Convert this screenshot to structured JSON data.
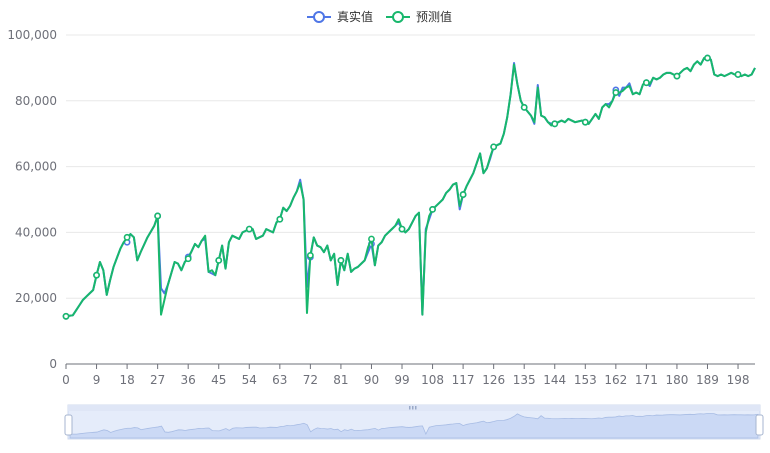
{
  "chart_data": {
    "type": "line",
    "title": "",
    "xlabel": "",
    "ylabel": "",
    "legend_position": "top-center",
    "x_tick_labels": [
      "0",
      "9",
      "18",
      "27",
      "36",
      "45",
      "54",
      "63",
      "72",
      "81",
      "90",
      "99",
      "108",
      "117",
      "126",
      "135",
      "144",
      "153",
      "162",
      "171",
      "180",
      "189",
      "198"
    ],
    "y_tick_labels": [
      "0",
      "20,000",
      "40,000",
      "60,000",
      "80,000",
      "100,000"
    ],
    "x_range": [
      0,
      203
    ],
    "ylim": [
      0,
      100000
    ],
    "grid": "horizontal",
    "anchors": [
      [
        0,
        14500
      ],
      [
        2,
        14800
      ],
      [
        5,
        19500
      ],
      [
        6,
        20500
      ],
      [
        8,
        22500
      ],
      [
        9,
        27000
      ],
      [
        10,
        31000
      ],
      [
        11,
        28500
      ],
      [
        12,
        21000
      ],
      [
        13,
        25500
      ],
      [
        14,
        29500
      ],
      [
        16,
        35000
      ],
      [
        17,
        37000
      ],
      [
        18,
        38500
      ],
      [
        19,
        39500
      ],
      [
        20,
        38500
      ],
      [
        21,
        31500
      ],
      [
        22,
        34000
      ],
      [
        24,
        38500
      ],
      [
        26,
        42000
      ],
      [
        27,
        45000
      ],
      [
        28,
        15000
      ],
      [
        29,
        19500
      ],
      [
        30,
        24000
      ],
      [
        32,
        31000
      ],
      [
        33,
        30500
      ],
      [
        34,
        28500
      ],
      [
        35,
        31000
      ],
      [
        36,
        32000
      ],
      [
        38,
        36500
      ],
      [
        39,
        35500
      ],
      [
        40,
        37500
      ],
      [
        41,
        39000
      ],
      [
        42,
        28000
      ],
      [
        43,
        28500
      ],
      [
        44,
        27000
      ],
      [
        46,
        36000
      ],
      [
        47,
        29000
      ],
      [
        48,
        37000
      ],
      [
        49,
        39000
      ],
      [
        51,
        38000
      ],
      [
        52,
        40000
      ],
      [
        54,
        41000
      ],
      [
        55,
        41000
      ],
      [
        56,
        38000
      ],
      [
        58,
        39000
      ],
      [
        59,
        41000
      ],
      [
        61,
        40000
      ],
      [
        62,
        43000
      ],
      [
        63,
        44000
      ],
      [
        64,
        47500
      ],
      [
        65,
        46500
      ],
      [
        66,
        48000
      ],
      [
        67,
        50500
      ],
      [
        68,
        52500
      ],
      [
        69,
        55000
      ],
      [
        70,
        50000
      ],
      [
        71,
        15500
      ],
      [
        72,
        33000
      ],
      [
        73,
        38500
      ],
      [
        74,
        36000
      ],
      [
        75,
        35500
      ],
      [
        76,
        34000
      ],
      [
        77,
        36000
      ],
      [
        78,
        31500
      ],
      [
        79,
        33500
      ],
      [
        80,
        24000
      ],
      [
        81,
        31500
      ],
      [
        82,
        28500
      ],
      [
        83,
        33500
      ],
      [
        84,
        28000
      ],
      [
        85,
        29000
      ],
      [
        86,
        29500
      ],
      [
        87,
        30500
      ],
      [
        88,
        31500
      ],
      [
        89,
        35500
      ],
      [
        90,
        38000
      ],
      [
        91,
        30000
      ],
      [
        92,
        36000
      ],
      [
        93,
        37000
      ],
      [
        94,
        39000
      ],
      [
        95,
        40000
      ],
      [
        96,
        41000
      ],
      [
        97,
        42000
      ],
      [
        98,
        44000
      ],
      [
        99,
        41000
      ],
      [
        100,
        40000
      ],
      [
        101,
        41000
      ],
      [
        103,
        45000
      ],
      [
        104,
        46000
      ],
      [
        105,
        15000
      ],
      [
        106,
        40000
      ],
      [
        107,
        45000
      ],
      [
        108,
        47000
      ],
      [
        109,
        48000
      ],
      [
        110,
        49000
      ],
      [
        111,
        50000
      ],
      [
        112,
        52000
      ],
      [
        113,
        53000
      ],
      [
        114,
        54500
      ],
      [
        115,
        55000
      ],
      [
        116,
        48000
      ],
      [
        117,
        51500
      ],
      [
        118,
        54000
      ],
      [
        120,
        58000
      ],
      [
        121,
        61000
      ],
      [
        122,
        64000
      ],
      [
        123,
        58000
      ],
      [
        124,
        59500
      ],
      [
        125,
        63000
      ],
      [
        126,
        66000
      ],
      [
        127,
        66500
      ],
      [
        128,
        67000
      ],
      [
        129,
        70000
      ],
      [
        130,
        75000
      ],
      [
        131,
        82000
      ],
      [
        132,
        91000
      ],
      [
        133,
        85000
      ],
      [
        134,
        80000
      ],
      [
        135,
        78000
      ],
      [
        137,
        75500
      ],
      [
        138,
        73500
      ],
      [
        139,
        84000
      ],
      [
        140,
        75500
      ],
      [
        141,
        75000
      ],
      [
        142,
        73500
      ],
      [
        143,
        72500
      ],
      [
        144,
        73000
      ],
      [
        146,
        74000
      ],
      [
        147,
        73500
      ],
      [
        148,
        74500
      ],
      [
        150,
        73500
      ],
      [
        152,
        74000
      ],
      [
        153,
        73500
      ],
      [
        154,
        73000
      ],
      [
        155,
        74500
      ],
      [
        156,
        76000
      ],
      [
        157,
        74500
      ],
      [
        158,
        78000
      ],
      [
        159,
        79000
      ],
      [
        160,
        78000
      ],
      [
        161,
        80000
      ],
      [
        162,
        82500
      ],
      [
        163,
        82500
      ],
      [
        164,
        83000
      ],
      [
        165,
        84000
      ],
      [
        166,
        84500
      ],
      [
        167,
        82000
      ],
      [
        168,
        82500
      ],
      [
        169,
        82000
      ],
      [
        170,
        85000
      ],
      [
        171,
        85500
      ],
      [
        172,
        85000
      ],
      [
        173,
        87000
      ],
      [
        174,
        86500
      ],
      [
        175,
        87000
      ],
      [
        176,
        88000
      ],
      [
        177,
        88500
      ],
      [
        178,
        88500
      ],
      [
        179,
        88000
      ],
      [
        180,
        87500
      ],
      [
        181,
        88500
      ],
      [
        182,
        89500
      ],
      [
        183,
        90000
      ],
      [
        184,
        89000
      ],
      [
        185,
        91000
      ],
      [
        186,
        92000
      ],
      [
        187,
        91000
      ],
      [
        188,
        93000
      ],
      [
        189,
        93000
      ],
      [
        190,
        92500
      ],
      [
        191,
        88000
      ],
      [
        192,
        87500
      ],
      [
        193,
        88000
      ],
      [
        194,
        87500
      ],
      [
        195,
        88000
      ],
      [
        196,
        88500
      ],
      [
        197,
        88000
      ],
      [
        198,
        88000
      ],
      [
        199,
        87500
      ],
      [
        200,
        88000
      ],
      [
        201,
        87500
      ],
      [
        202,
        88000
      ],
      [
        203,
        90000
      ]
    ],
    "series": [
      {
        "name": "真实值",
        "color": "#4f76e6",
        "offsets": [
          [
            18,
            -1500
          ],
          [
            28,
            8000
          ],
          [
            29,
            2000
          ],
          [
            36,
            500
          ],
          [
            41,
            -1000
          ],
          [
            43,
            -1000
          ],
          [
            69,
            1000
          ],
          [
            71,
            8000
          ],
          [
            72,
            -500
          ],
          [
            89,
            -1500
          ],
          [
            90,
            -1500
          ],
          [
            98,
            -1000
          ],
          [
            106,
            1000
          ],
          [
            107,
            -1000
          ],
          [
            116,
            -1000
          ],
          [
            125,
            -500
          ],
          [
            132,
            500
          ],
          [
            138,
            -500
          ],
          [
            139,
            800
          ],
          [
            143,
            500
          ],
          [
            160,
            1000
          ],
          [
            162,
            800
          ],
          [
            163,
            -1000
          ],
          [
            164,
            1000
          ],
          [
            166,
            800
          ],
          [
            172,
            -500
          ]
        ],
        "markers": [
          0,
          9,
          18,
          27,
          36,
          45,
          54,
          63,
          72,
          81,
          90,
          99,
          108,
          117,
          126,
          135,
          144,
          153,
          162,
          171,
          180,
          189,
          198
        ]
      },
      {
        "name": "预测值",
        "color": "#18b76c",
        "offsets": [],
        "markers": [
          0,
          9,
          18,
          27,
          36,
          45,
          54,
          63,
          72,
          81,
          90,
          99,
          108,
          117,
          126,
          135,
          144,
          153,
          162,
          171,
          180,
          189,
          198
        ]
      }
    ]
  }
}
